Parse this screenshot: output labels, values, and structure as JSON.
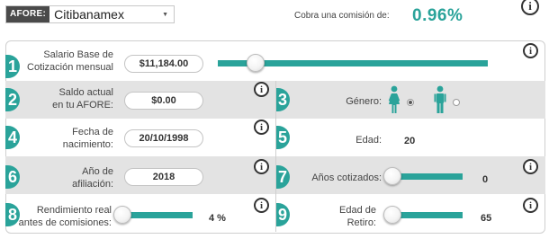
{
  "header": {
    "afore_label": "AFORE:",
    "afore_value": "Citibanamex",
    "commission_label": "Cobra una comisión de:",
    "commission_value": "0.96%"
  },
  "info_glyph": "i",
  "fields": {
    "salario": {
      "number": "1",
      "label_1": "Salario Base de",
      "label_2": "Cotización mensual",
      "value": "$11,184.00",
      "slider_fraction": 0.14
    },
    "saldo": {
      "number": "2",
      "label_1": "Saldo actual",
      "label_2": "en tu AFORE:",
      "value": "$0.00"
    },
    "genero": {
      "number": "3",
      "label": "Género:",
      "selected": "female"
    },
    "fecha": {
      "number": "4",
      "label_1": "Fecha de",
      "label_2": "nacimiento:",
      "value": "20/10/1998"
    },
    "edad": {
      "number": "5",
      "label": "Edad:",
      "value": "20"
    },
    "afiliacion": {
      "number": "6",
      "label_1": "Año de",
      "label_2": "afiliación:",
      "value": "2018"
    },
    "anos_cotizados": {
      "number": "7",
      "label": "Años cotizados:",
      "value": "0"
    },
    "rendimiento": {
      "number": "8",
      "label_1": "Rendimiento real",
      "label_2": "antes de comisiones:",
      "value": "4 %"
    },
    "edad_retiro": {
      "number": "9",
      "label_1": "Edad de",
      "label_2": "Retiro:",
      "value": "65"
    }
  },
  "colors": {
    "accent": "#2aa39a",
    "row_gray": "#e3e3e3",
    "dark": "#333333"
  },
  "icons": [
    "info-icon",
    "female-person-icon",
    "male-person-icon",
    "dropdown-caret-icon"
  ]
}
